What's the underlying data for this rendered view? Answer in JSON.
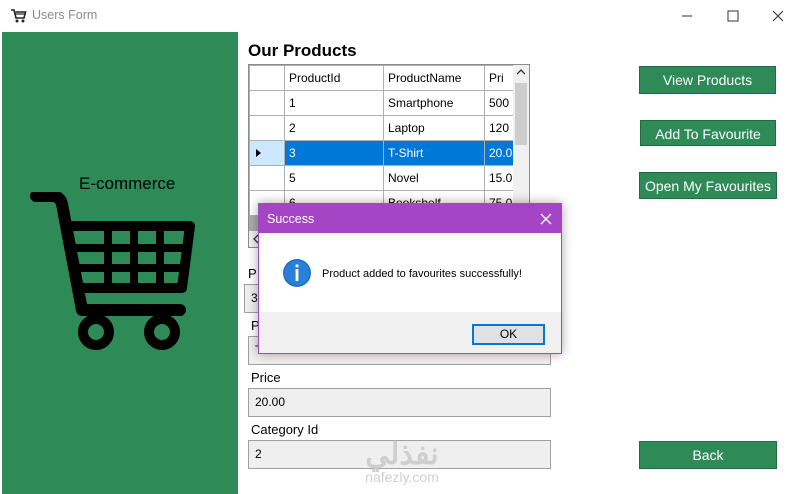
{
  "window": {
    "title": "Users Form"
  },
  "brand": {
    "text": "E-commerce"
  },
  "products": {
    "heading": "Our Products",
    "columns": [
      "ProductId",
      "ProductName",
      "Pri"
    ],
    "rows": [
      [
        "1",
        "Smartphone",
        "500"
      ],
      [
        "2",
        "Laptop",
        "120"
      ],
      [
        "3",
        "T-Shirt",
        "20.0"
      ],
      [
        "5",
        "Novel",
        "15.0"
      ],
      [
        "6",
        "Bookshelf",
        "75.0"
      ]
    ],
    "selected_row": 2
  },
  "form": {
    "id_label": "P",
    "id_value": "3",
    "name_label": "P",
    "name_value": "T",
    "price_label": "Price",
    "price_value": "20.00",
    "category_label": "Category Id",
    "category_value": "2"
  },
  "buttons": {
    "view_products": "View Products",
    "add_favourite": "Add To Favourite",
    "open_favourites": "Open My Favourites",
    "back": "Back"
  },
  "dialog": {
    "title": "Success",
    "message": "Product added to favourites successfully!",
    "ok": "OK",
    "icon": "info-icon"
  },
  "watermark": {
    "arabic": "نفذلي",
    "latin": "nafezly.com"
  },
  "colors": {
    "panel_green": "#2e8b57",
    "selection_blue": "#0078d7",
    "dialog_title": "#a545c6"
  }
}
